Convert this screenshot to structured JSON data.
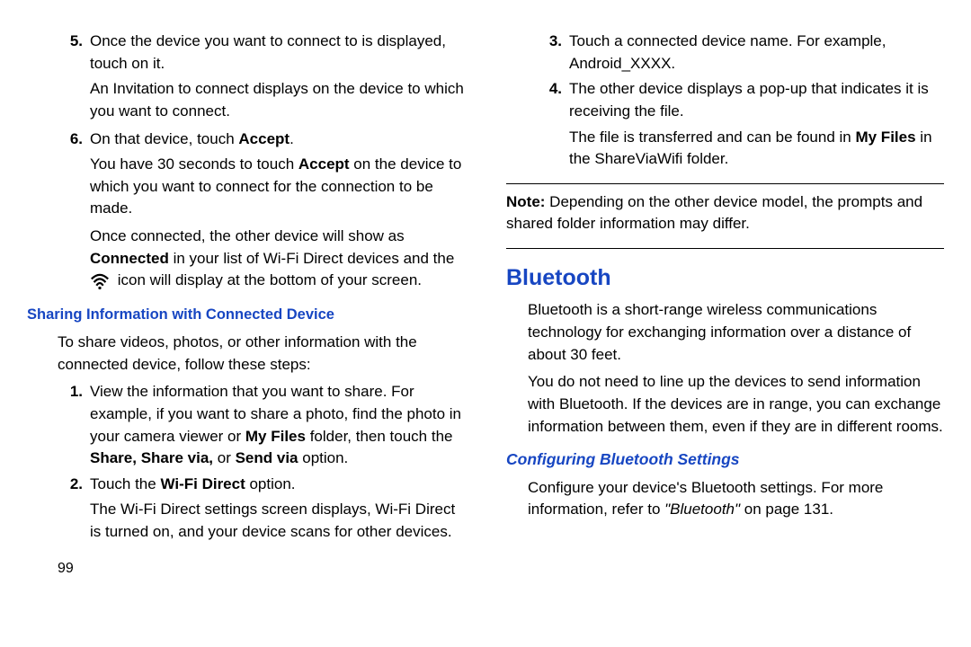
{
  "left": {
    "item5": {
      "num": "5.",
      "text_a": "Once the device you want to connect to is displayed, touch on it.",
      "text_b": "An Invitation to connect displays on the device to which you want to connect."
    },
    "item6": {
      "num": "6.",
      "pre": "On that device, touch ",
      "bold": "Accept",
      "post": ".",
      "p1_pre": "You have 30 seconds to touch ",
      "p1_bold": "Accept",
      "p1_post": " on the device to which you want to connect for the connection to be made.",
      "p2_pre": "Once connected, the other device will show as ",
      "p2_bold": "Connected",
      "p2_mid": " in your list of Wi-Fi Direct devices and the ",
      "p2_post": " icon will display at the bottom of your screen."
    },
    "sub_heading": "Sharing Information with Connected Device",
    "intro": "To share videos, photos, or other information with the connected device, follow these steps:",
    "s1": {
      "num": "1.",
      "a": "View the information that you want to share. For example, if you want to share a photo, find the photo in your camera viewer or ",
      "b": "My Files",
      "c": " folder, then touch the ",
      "d": "Share, Share via,",
      "e": " or ",
      "f": "Send via",
      "g": " option."
    },
    "s2": {
      "num": "2.",
      "a": "Touch the ",
      "b": "Wi-Fi Direct",
      "c": " option.",
      "p": "The Wi-Fi Direct settings screen displays, Wi-Fi Direct is turned on, and your device scans for other devices."
    },
    "page_num": "99"
  },
  "right": {
    "s3": {
      "num": "3.",
      "text": "Touch a connected device name. For example, Android_XXXX."
    },
    "s4": {
      "num": "4.",
      "text": "The other device displays a pop-up that indicates it is receiving the file.",
      "p_a": "The file is transferred and can be found in ",
      "p_b": "My Files",
      "p_c": " in the ShareViaWifi folder."
    },
    "note_label": "Note:",
    "note_text": " Depending on the other device model, the prompts and shared folder information may differ.",
    "bt_title": "Bluetooth",
    "bt_p1": "Bluetooth is a short-range wireless communications technology for exchanging information over a distance of about 30 feet.",
    "bt_p2": "You do not need to line up the devices to send information with Bluetooth. If the devices are in range, you can exchange information between them, even if they are in different rooms.",
    "bt_sub": "Configuring Bluetooth Settings",
    "bt_cfg_a": "Configure your device's Bluetooth settings. For more information, refer to ",
    "bt_cfg_b": "\"Bluetooth\"",
    "bt_cfg_c": " on page 131."
  }
}
